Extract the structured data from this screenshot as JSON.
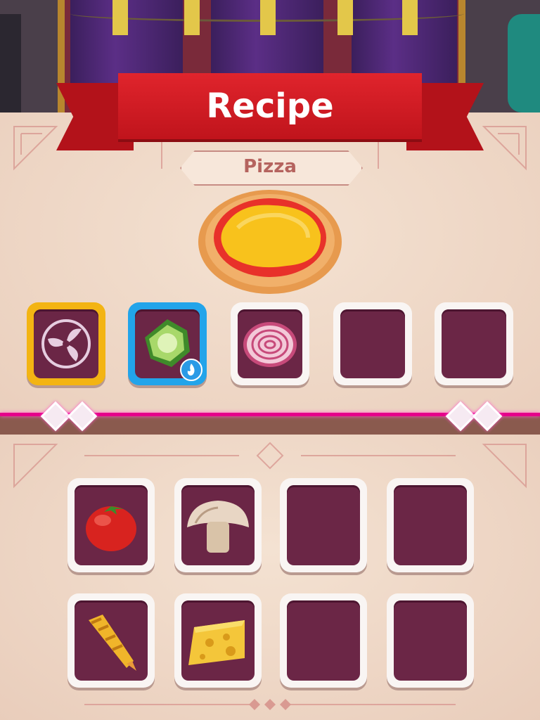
{
  "title": "Recipe",
  "recipe_name": "Pizza",
  "dish": {
    "name": "pizza-image",
    "icon": "pizza-icon"
  },
  "recipe_slots": [
    {
      "icon": "fan-icon",
      "frame": "gold"
    },
    {
      "icon": "green-pepper-icon",
      "frame": "blue",
      "badge": "fire-icon"
    },
    {
      "icon": "onion-icon",
      "frame": "white"
    },
    {
      "icon": "",
      "frame": "white"
    },
    {
      "icon": "",
      "frame": "white"
    }
  ],
  "ingredient_slots": [
    {
      "icon": "tomato-icon"
    },
    {
      "icon": "mushroom-icon"
    },
    {
      "icon": ""
    },
    {
      "icon": ""
    },
    {
      "icon": "corn-icon"
    },
    {
      "icon": "cheese-icon"
    },
    {
      "icon": ""
    },
    {
      "icon": ""
    }
  ],
  "colors": {
    "banner_red": "#c0141c",
    "slot_interior": "#6b2646",
    "gold_frame": "#f3b413",
    "blue_frame": "#22a4ea",
    "divider": "#e5008a",
    "label_text": "#b5635e"
  }
}
